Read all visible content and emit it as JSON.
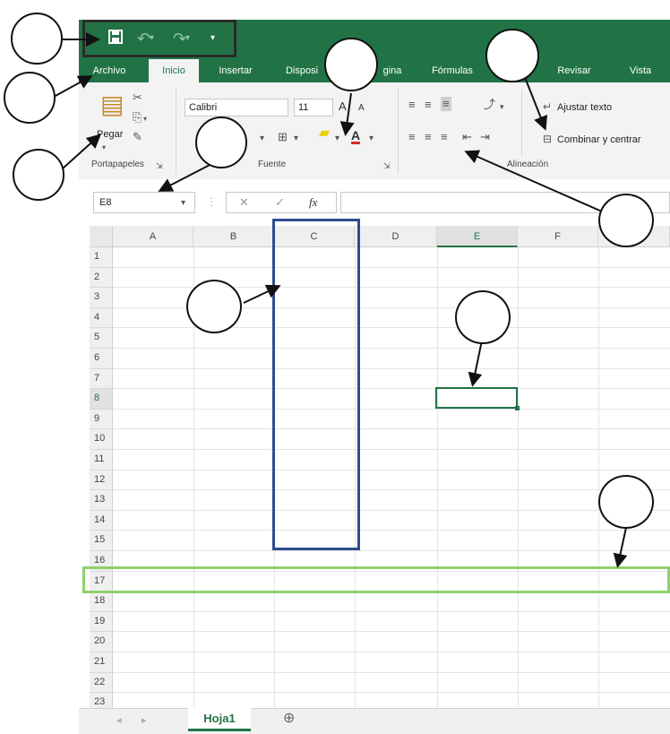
{
  "title_bar": {
    "quick_access": {
      "save_icon": "save-icon",
      "undo_icon": "undo-icon",
      "redo_icon": "redo-icon",
      "customize_icon": "customize-qat-icon"
    }
  },
  "ribbon_tabs": [
    "Archivo",
    "Inicio",
    "Insertar",
    "Disposi",
    "gina",
    "Fórmulas",
    "Revisar",
    "Vista"
  ],
  "ribbon": {
    "clipboard": {
      "paste_label": "Pegar",
      "group_label": "Portapapeles"
    },
    "font": {
      "family": "Calibri",
      "size": "11",
      "grow": "A",
      "shrink": "A",
      "border_icon": "border-icon",
      "fill_icon": "fill-color-icon",
      "font_color_label": "A",
      "group_label": "Fuente"
    },
    "alignment": {
      "wrap_label": "Ajustar texto",
      "merge_label": "Combinar y centrar",
      "group_label": "Alineación"
    }
  },
  "formula_bar": {
    "name_box": "E8",
    "cancel": "✕",
    "enter": "✓",
    "fx": "fx",
    "value": ""
  },
  "grid": {
    "columns": [
      "A",
      "B",
      "C",
      "D",
      "E",
      "F"
    ],
    "rows": [
      "1",
      "2",
      "3",
      "4",
      "5",
      "6",
      "7",
      "8",
      "9",
      "10",
      "11",
      "12",
      "13",
      "14",
      "15",
      "16",
      "17",
      "18",
      "19",
      "20",
      "21",
      "22",
      "23"
    ],
    "active_cell": "E8"
  },
  "sheet_tabs": {
    "tabs": [
      "Hoja1"
    ],
    "add_label": "⊕"
  },
  "colors": {
    "excel_green": "#217346",
    "column_highlight": "#2e4d8f",
    "row_highlight": "#8fd06c"
  }
}
